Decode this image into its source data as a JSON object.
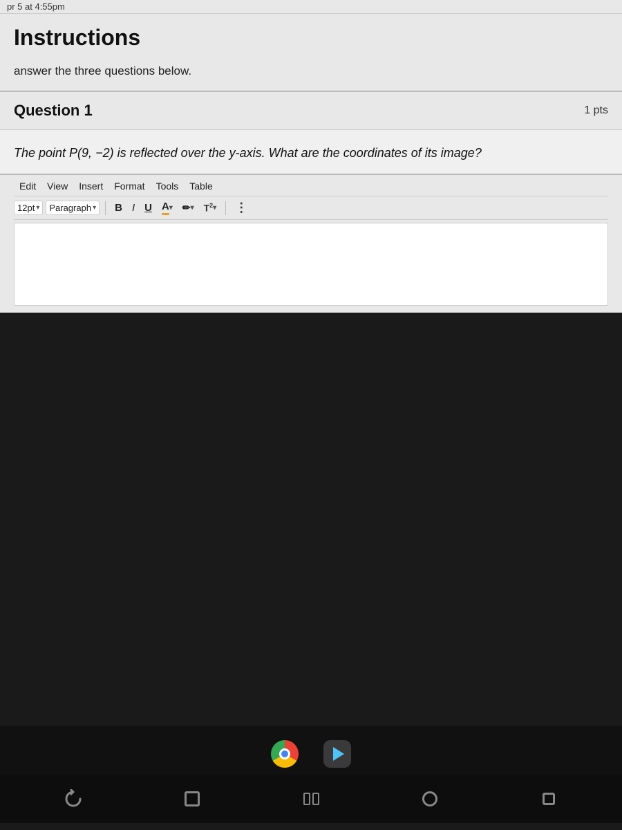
{
  "topbar": {
    "time": "pr 5 at 4:55pm"
  },
  "instructions": {
    "title": "Instructions",
    "body": "answer the three questions below."
  },
  "question1": {
    "title": "Question 1",
    "pts": "1 pts",
    "text": "The point P(9, −2) is reflected over the y-axis. What are the coordinates of its image?"
  },
  "editor": {
    "menu": {
      "edit": "Edit",
      "view": "View",
      "insert": "Insert",
      "format": "Format",
      "tools": "Tools",
      "table": "Table"
    },
    "toolbar": {
      "font_size": "12pt",
      "font_size_chevron": "▾",
      "paragraph": "Paragraph",
      "paragraph_chevron": "▾",
      "bold": "B",
      "italic": "I",
      "underline": "U",
      "font_color": "A",
      "more_options": "⋮"
    },
    "placeholder": ""
  },
  "dock": {
    "chrome_label": "Chrome",
    "play_label": "Play"
  },
  "navbar": {
    "back": "back",
    "window": "window",
    "dual": "dual",
    "circle": "circle",
    "small": "small"
  }
}
